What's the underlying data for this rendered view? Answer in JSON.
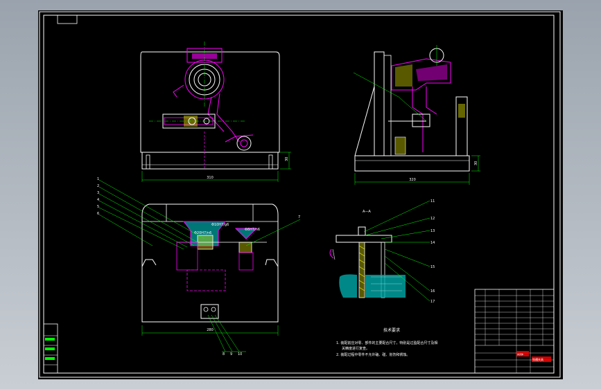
{
  "dimensions": {
    "front_width": "310",
    "front_height": "30",
    "side_width": "320",
    "side_height": "30",
    "top_width": "280"
  },
  "section_label": "A—A",
  "fit_labels": {
    "fit_1": "Φ10H7/g6",
    "fit_2": "Φ20H7/n6",
    "fit_3": "Φ8H7/n6"
  },
  "balloons": [
    "1",
    "2",
    "3",
    "4",
    "5",
    "6",
    "7",
    "8",
    "9",
    "10",
    "11",
    "12",
    "13",
    "14",
    "15",
    "16",
    "17"
  ],
  "notes": {
    "heading": "技术要求",
    "line1": "1. 装配前应对零、部件的主要配合尺寸，特别是过盈配合尺寸及相",
    "line2": "关精度进行复查。",
    "line3": "2. 装配过程中零件不允许磕、碰、划伤和锈蚀。"
  },
  "title_block": {
    "drawing_name": "铣槽夹具",
    "part_tag": "夹具体"
  },
  "colors": {
    "background": "#000000",
    "frame": "#ffffff",
    "geometry": "#ffffff",
    "dimension": "#00ff00",
    "part": "#ff00ff",
    "hatch": "#ffff00",
    "label_red": "#ff0000"
  }
}
